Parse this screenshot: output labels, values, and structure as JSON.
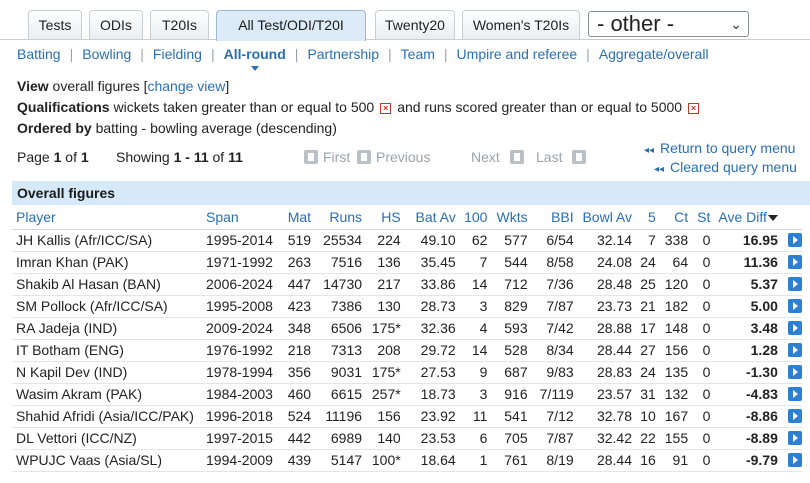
{
  "tabs": [
    {
      "label": "Tests",
      "active": false
    },
    {
      "label": "ODIs",
      "active": false
    },
    {
      "label": "T20Is",
      "active": false
    },
    {
      "label": "All Test/ODI/T20I",
      "active": true
    },
    {
      "label": "Twenty20",
      "active": false
    },
    {
      "label": "Women's T20Is",
      "active": false
    }
  ],
  "other_select": {
    "value": "- other -"
  },
  "subnav": [
    {
      "label": "Batting",
      "active": false
    },
    {
      "label": "Bowling",
      "active": false
    },
    {
      "label": "Fielding",
      "active": false
    },
    {
      "label": "All-round",
      "active": true
    },
    {
      "label": "Partnership",
      "active": false
    },
    {
      "label": "Team",
      "active": false
    },
    {
      "label": "Umpire and referee",
      "active": false
    },
    {
      "label": "Aggregate/overall",
      "active": false
    }
  ],
  "view": {
    "label": "View",
    "text": "overall figures",
    "link": "change view"
  },
  "qualifications": {
    "label": "Qualifications",
    "q1": "wickets taken greater than or equal to 500",
    "q2": "and runs scored greater than or equal to 5000",
    "remove_symbol": "×"
  },
  "ordered": {
    "label": "Ordered by",
    "text": "batting - bowling average (descending)"
  },
  "pager": {
    "page_word": "Page",
    "page": "1",
    "of_word": "of",
    "pages": "1",
    "showing_word": "Showing",
    "range": "1 - 11",
    "of_word2": "of",
    "total": "11",
    "first": "First",
    "previous": "Previous",
    "next": "Next",
    "last": "Last"
  },
  "query_links": {
    "return_icon": "◂◂",
    "return_label": "Return to query menu",
    "cleared_icon": "◂◂",
    "cleared_label": "Cleared query menu"
  },
  "table": {
    "caption": "Overall figures",
    "columns": [
      "Player",
      "Span",
      "Mat",
      "Runs",
      "HS",
      "Bat Av",
      "100",
      "Wkts",
      "BBI",
      "Bowl Av",
      "5",
      "Ct",
      "St",
      "Ave Diff"
    ],
    "rows": [
      [
        "JH Kallis (Afr/ICC/SA)",
        "1995-2014",
        "519",
        "25534",
        "224",
        "49.10",
        "62",
        "577",
        "6/54",
        "32.14",
        "7",
        "338",
        "0",
        "16.95"
      ],
      [
        "Imran Khan (PAK)",
        "1971-1992",
        "263",
        "7516",
        "136",
        "35.45",
        "7",
        "544",
        "8/58",
        "24.08",
        "24",
        "64",
        "0",
        "11.36"
      ],
      [
        "Shakib Al Hasan (BAN)",
        "2006-2024",
        "447",
        "14730",
        "217",
        "33.86",
        "14",
        "712",
        "7/36",
        "28.48",
        "25",
        "120",
        "0",
        "5.37"
      ],
      [
        "SM Pollock (Afr/ICC/SA)",
        "1995-2008",
        "423",
        "7386",
        "130",
        "28.73",
        "3",
        "829",
        "7/87",
        "23.73",
        "21",
        "182",
        "0",
        "5.00"
      ],
      [
        "RA Jadeja (IND)",
        "2009-2024",
        "348",
        "6506",
        "175*",
        "32.36",
        "4",
        "593",
        "7/42",
        "28.88",
        "17",
        "148",
        "0",
        "3.48"
      ],
      [
        "IT Botham (ENG)",
        "1976-1992",
        "218",
        "7313",
        "208",
        "29.72",
        "14",
        "528",
        "8/34",
        "28.44",
        "27",
        "156",
        "0",
        "1.28"
      ],
      [
        "N Kapil Dev (IND)",
        "1978-1994",
        "356",
        "9031",
        "175*",
        "27.53",
        "9",
        "687",
        "9/83",
        "28.83",
        "24",
        "135",
        "0",
        "-1.30"
      ],
      [
        "Wasim Akram (PAK)",
        "1984-2003",
        "460",
        "6615",
        "257*",
        "18.73",
        "3",
        "916",
        "7/119",
        "23.57",
        "31",
        "132",
        "0",
        "-4.83"
      ],
      [
        "Shahid Afridi (Asia/ICC/PAK)",
        "1996-2018",
        "524",
        "11196",
        "156",
        "23.92",
        "11",
        "541",
        "7/12",
        "32.78",
        "10",
        "167",
        "0",
        "-8.86"
      ],
      [
        "DL Vettori (ICC/NZ)",
        "1997-2015",
        "442",
        "6989",
        "140",
        "23.53",
        "6",
        "705",
        "7/87",
        "32.42",
        "22",
        "155",
        "0",
        "-8.89"
      ],
      [
        "WPUJC Vaas (Asia/SL)",
        "1994-2009",
        "439",
        "5147",
        "100*",
        "18.64",
        "1",
        "761",
        "8/19",
        "28.44",
        "16",
        "91",
        "0",
        "-9.79"
      ]
    ]
  }
}
